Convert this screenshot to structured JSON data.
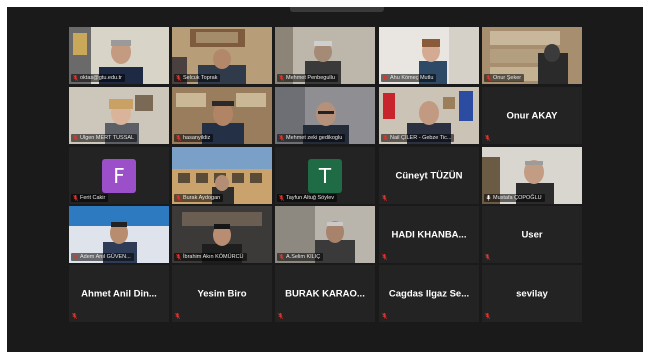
{
  "meeting": {
    "participants": [
      {
        "label": "oktas@gtu.edu.tr",
        "kind": "video",
        "scene": "office-portrait",
        "muted": true
      },
      {
        "label": "Selcuk Toprak",
        "kind": "video",
        "scene": "office-shelf",
        "muted": true
      },
      {
        "label": "Mehmet Penbegullu",
        "kind": "video",
        "scene": "home-wall",
        "muted": true
      },
      {
        "label": "Ahu Kömeç Mutlu",
        "kind": "video",
        "scene": "bright-room",
        "muted": true
      },
      {
        "label": "Onur Şeker",
        "kind": "video",
        "scene": "bookshelf",
        "muted": true
      },
      {
        "label": "Ulgen MERT TUSSAL",
        "kind": "video",
        "scene": "woman-room",
        "muted": true
      },
      {
        "label": "hasanyildiz",
        "kind": "video",
        "scene": "office-desk",
        "muted": true
      },
      {
        "label": "Mehmet zeki gedikoglu",
        "kind": "video",
        "scene": "man-glasses",
        "muted": true
      },
      {
        "label": "Nail ÇİLER - Gebze Tic...",
        "kind": "video",
        "scene": "flags-office",
        "muted": true
      },
      {
        "label": "",
        "name": "Onur AKAY",
        "kind": "name",
        "muted": true
      },
      {
        "label": "Ferit Cakir",
        "kind": "avatar",
        "letter": "F",
        "color": "#9b4fc8",
        "muted": true
      },
      {
        "label": "Burak Aydogan",
        "kind": "video",
        "scene": "building",
        "muted": true
      },
      {
        "label": "Tayfun Altuğ Söylev",
        "kind": "avatar",
        "letter": "T",
        "color": "#1f6b46",
        "muted": true
      },
      {
        "label": "",
        "name": "Cüneyt TÜZÜN",
        "kind": "name",
        "muted": true
      },
      {
        "label": "Mustafa ÇOPOĞLU",
        "kind": "video",
        "scene": "active-man",
        "muted": false,
        "active": true
      },
      {
        "label": "Adem Anıl GÜVEN...",
        "kind": "video",
        "scene": "young-man-blue",
        "muted": true
      },
      {
        "label": "İbrahim Akın KÖMÜRCÜ",
        "kind": "video",
        "scene": "young-man-shelf",
        "muted": true
      },
      {
        "label": "A.Selim KILIÇ",
        "kind": "video",
        "scene": "man-room",
        "muted": true
      },
      {
        "label": "",
        "name": "HADI KHANBA...",
        "kind": "name",
        "muted": true
      },
      {
        "label": "",
        "name": "User",
        "kind": "name",
        "muted": true
      },
      {
        "label": "",
        "name": "Ahmet Anil Din...",
        "kind": "name",
        "muted": true
      },
      {
        "label": "",
        "name": "Yesim Biro",
        "kind": "name",
        "muted": true
      },
      {
        "label": "",
        "name": "BURAK KARAO...",
        "kind": "name",
        "muted": true
      },
      {
        "label": "",
        "name": "Cagdas Ilgaz Se...",
        "kind": "name",
        "muted": true
      },
      {
        "label": "",
        "name": "sevilay",
        "kind": "name",
        "muted": true
      }
    ]
  },
  "colors": {
    "background": "#1a1a1a",
    "tile": "#232323",
    "mic_muted": "#e0332e",
    "active_border": "#c9d23a"
  }
}
